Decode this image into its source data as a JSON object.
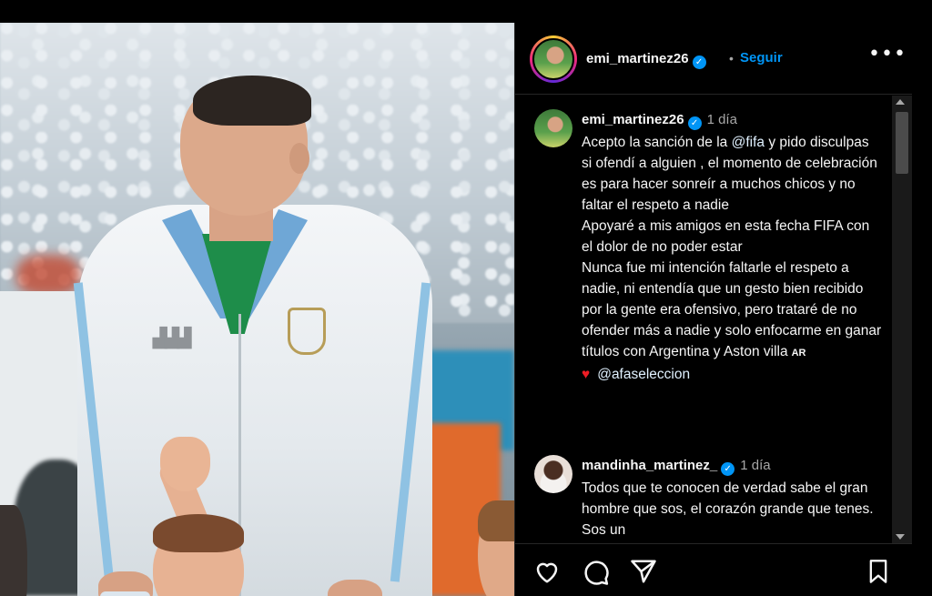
{
  "post": {
    "photo_desc": "",
    "header": {
      "username": "emi_martinez26",
      "verified": true,
      "separator": "•",
      "follow_label": "Seguir",
      "more_icon": "more-horizontal-icon"
    },
    "caption": {
      "username": "emi_martinez26",
      "time": "1 día",
      "lines": [
        "Acepto la sanción de la ",
        "@fifa",
        " y pido disculpas si ofendí a alguien , el momento de celebración es para hacer sonreír a muchos chicos y no faltar el respeto a nadie",
        "Apoyaré a mis amigos en esta fecha FIFA con el dolor de no poder estar",
        "Nunca fue mi intención faltarle el respeto a nadie, ni entendía que un gesto bien recibido por la gente era ofensivo, pero trataré de no ofender más a nadie y solo enfocarme en ganar títulos con Argentina y Aston villa",
        "AR",
        "@afaseleccion"
      ]
    },
    "comment": {
      "username": "mandinha_martinez_",
      "time": "1 día",
      "text": "Todos que te conocen de verdad sabe el gran hombre que sos, el corazón grande que tenes. Sos un"
    },
    "actions": {
      "like_icon": "heart-icon",
      "comment_icon": "comment-icon",
      "share_icon": "send-icon",
      "save_icon": "bookmark-icon"
    }
  },
  "colors": {
    "accent": "#0095f6",
    "background": "#000000",
    "text": "#f5f5f5",
    "muted": "#a8a8a8"
  }
}
